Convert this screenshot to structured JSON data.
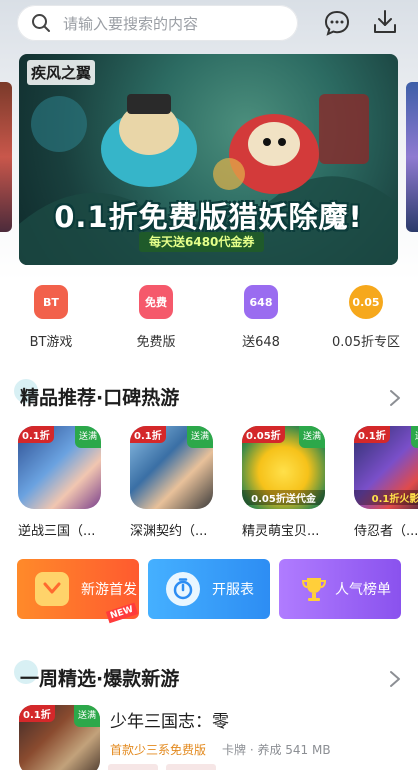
{
  "search": {
    "placeholder": "请输入要搜索的内容"
  },
  "icons": {
    "search": "search-icon",
    "message": "message-icon",
    "download": "download-icon"
  },
  "banner": {
    "logo": "疾风之翼",
    "headline": "0.1折免费版猎妖除魔!",
    "tagline": "每天送6480代金券"
  },
  "categories": [
    {
      "label": "BT游戏",
      "icon_text": "BT",
      "color": "#f2614b"
    },
    {
      "label": "免费版",
      "icon_text": "免费",
      "color": "#f5596b"
    },
    {
      "label": "送648",
      "icon_text": "648",
      "color": "#9a6cf0"
    },
    {
      "label": "0.05折专区",
      "icon_text": "0.05",
      "color": "#f6a81c"
    }
  ],
  "section1": {
    "title": "精品推荐·口碑热游"
  },
  "games": [
    {
      "name": "逆战三国（...",
      "badge": "0.1折",
      "tag": "送满"
    },
    {
      "name": "深渊契约（...",
      "badge": "0.1折",
      "tag": "送满"
    },
    {
      "name": "精灵萌宝贝...",
      "badge": "0.05折",
      "tag": "送满",
      "overlay": "0.05折送代金"
    },
    {
      "name": "侍忍者（...",
      "badge": "0.1折",
      "tag": "送满",
      "overlay": "0.1折火影"
    }
  ],
  "features": [
    {
      "label": "新游首发",
      "tag": "NEW",
      "color": "#ff6a2f"
    },
    {
      "label": "开服表",
      "color": "#2f9af5"
    },
    {
      "label": "人气榜单",
      "color": "#9a5cf0"
    }
  ],
  "section2": {
    "title": "一周精选·爆款新游"
  },
  "featured_game": {
    "name": "少年三国志：零",
    "desc": "首款少三系免费版",
    "meta": "卡牌 · 养成  541 MB",
    "badge": "0.1折",
    "tag": "送满"
  }
}
